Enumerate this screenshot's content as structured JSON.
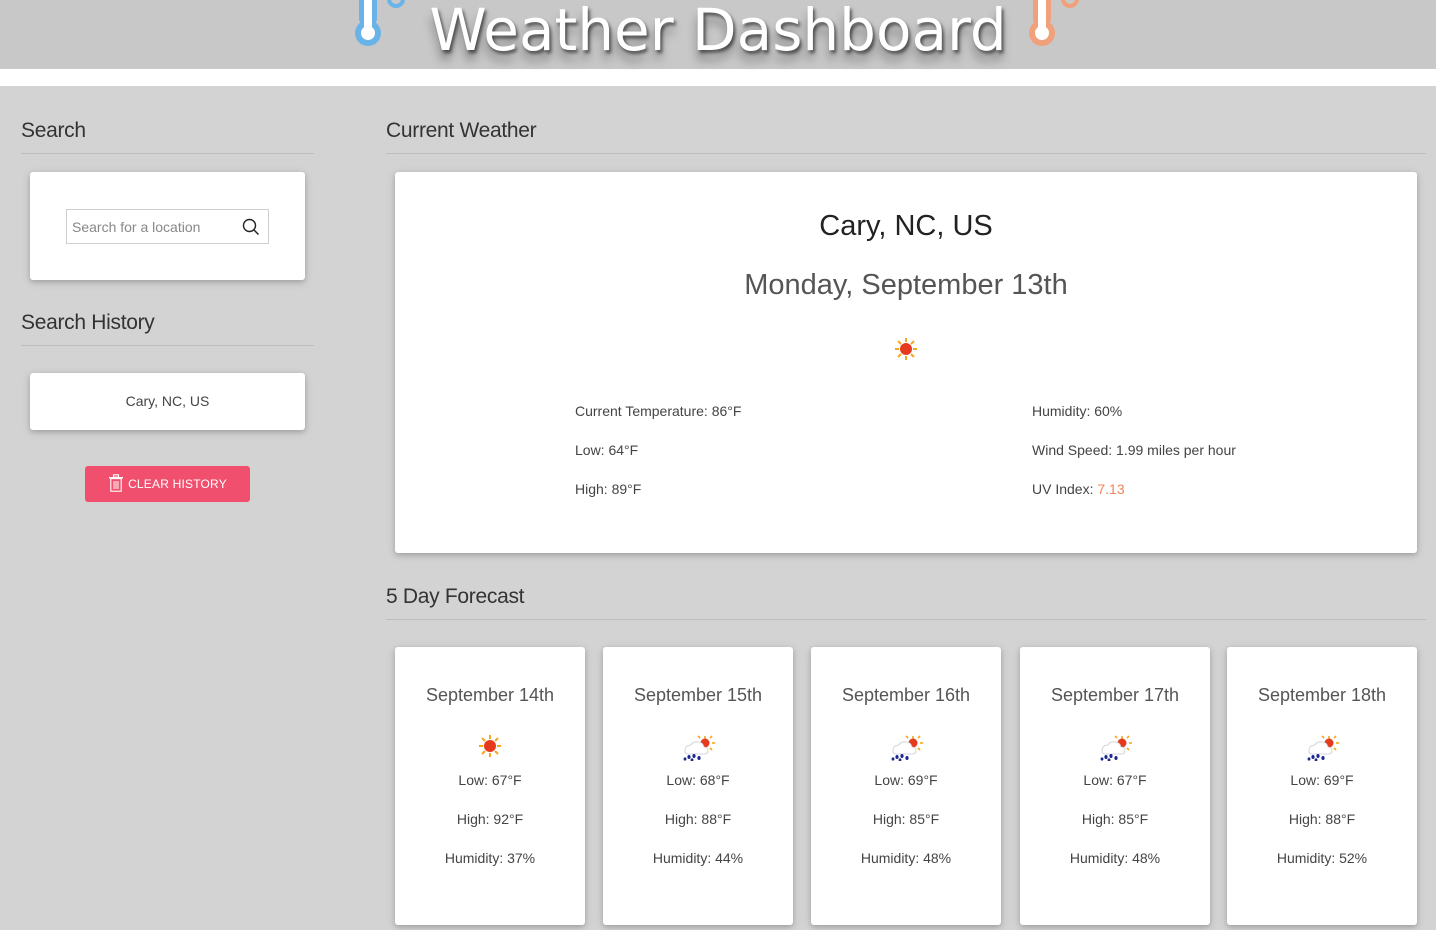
{
  "header": {
    "title": "Weather Dashboard",
    "left_icon": "thermometer-cold-icon",
    "right_icon": "thermometer-hot-icon",
    "cold_color": "#6ab3e8",
    "hot_color": "#f0a07a"
  },
  "sidebar": {
    "search_title": "Search",
    "search_placeholder": "Search for a location",
    "search_icon": "search-icon",
    "history_title": "Search History",
    "history_items": [
      "Cary, NC, US"
    ],
    "clear_label": "CLEAR HISTORY",
    "clear_icon": "trash-icon",
    "clear_color": "#f0506e"
  },
  "current": {
    "section_title": "Current Weather",
    "city": "Cary, NC, US",
    "date": "Monday, September 13th",
    "icon": "sun-icon",
    "temperature": "Current Temperature: 86°F",
    "low": "Low: 64°F",
    "high": "High: 89°F",
    "humidity": "Humidity: 60%",
    "wind": "Wind Speed: 1.99 miles per hour",
    "uv_label": "UV Index: ",
    "uv_value": "7.13",
    "uv_color": "#f0845b"
  },
  "forecast": {
    "section_title": "5 Day Forecast",
    "days": [
      {
        "date": "September 14th",
        "icon": "sun-icon",
        "low": "Low: 67°F",
        "high": "High: 92°F",
        "humidity": "Humidity: 37%"
      },
      {
        "date": "September 15th",
        "icon": "sun-rain-cloud-icon",
        "low": "Low: 68°F",
        "high": "High: 88°F",
        "humidity": "Humidity: 44%"
      },
      {
        "date": "September 16th",
        "icon": "sun-rain-cloud-icon",
        "low": "Low: 69°F",
        "high": "High: 85°F",
        "humidity": "Humidity: 48%"
      },
      {
        "date": "September 17th",
        "icon": "sun-rain-cloud-icon",
        "low": "Low: 67°F",
        "high": "High: 85°F",
        "humidity": "Humidity: 48%"
      },
      {
        "date": "September 18th",
        "icon": "sun-rain-cloud-icon",
        "low": "Low: 69°F",
        "high": "High: 88°F",
        "humidity": "Humidity: 52%"
      }
    ]
  }
}
